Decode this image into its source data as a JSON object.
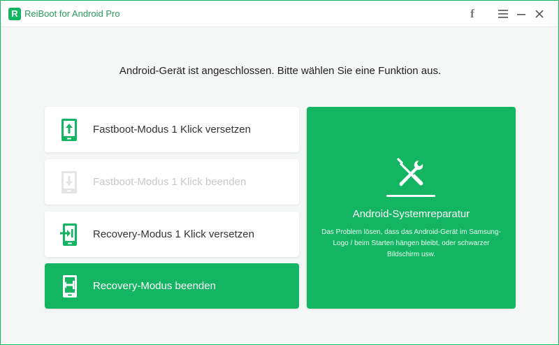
{
  "app": {
    "logo_letter": "R",
    "title": "ReiBoot for Android Pro"
  },
  "titlebar": {
    "facebook_icon": "facebook-icon",
    "facebook_glyph": "f",
    "menu_icon": "hamburger-menu-icon",
    "minimize_icon": "minimize-icon",
    "close_icon": "close-icon",
    "close_glyph": "✕"
  },
  "main": {
    "instruction": "Android-Gerät ist angeschlossen. Bitte wählen Sie eine Funktion aus.",
    "options": [
      {
        "label": "Fastboot-Modus 1 Klick versetzen",
        "icon": "phone-arrow-up-icon",
        "state": "enabled"
      },
      {
        "label": "Fastboot-Modus 1 Klick beenden",
        "icon": "phone-arrow-down-icon",
        "state": "disabled"
      },
      {
        "label": "Recovery-Modus 1 Klick versetzen",
        "icon": "phone-enter-icon",
        "state": "enabled"
      },
      {
        "label": "Recovery-Modus beenden",
        "icon": "phone-exit-icon",
        "state": "active"
      }
    ],
    "repair": {
      "icon": "wrench-screwdriver-icon",
      "title": "Android-Systemreparatur",
      "description": "Das Problem lösen, dass das Android-Gerät im Samsung-Logo / beim Starten hängen bleibt, oder schwarzer Bildschirm usw."
    }
  },
  "colors": {
    "accent": "#13b563",
    "border": "#11b562",
    "background": "#f5f6f6",
    "disabled_text": "#c8c8c8"
  }
}
